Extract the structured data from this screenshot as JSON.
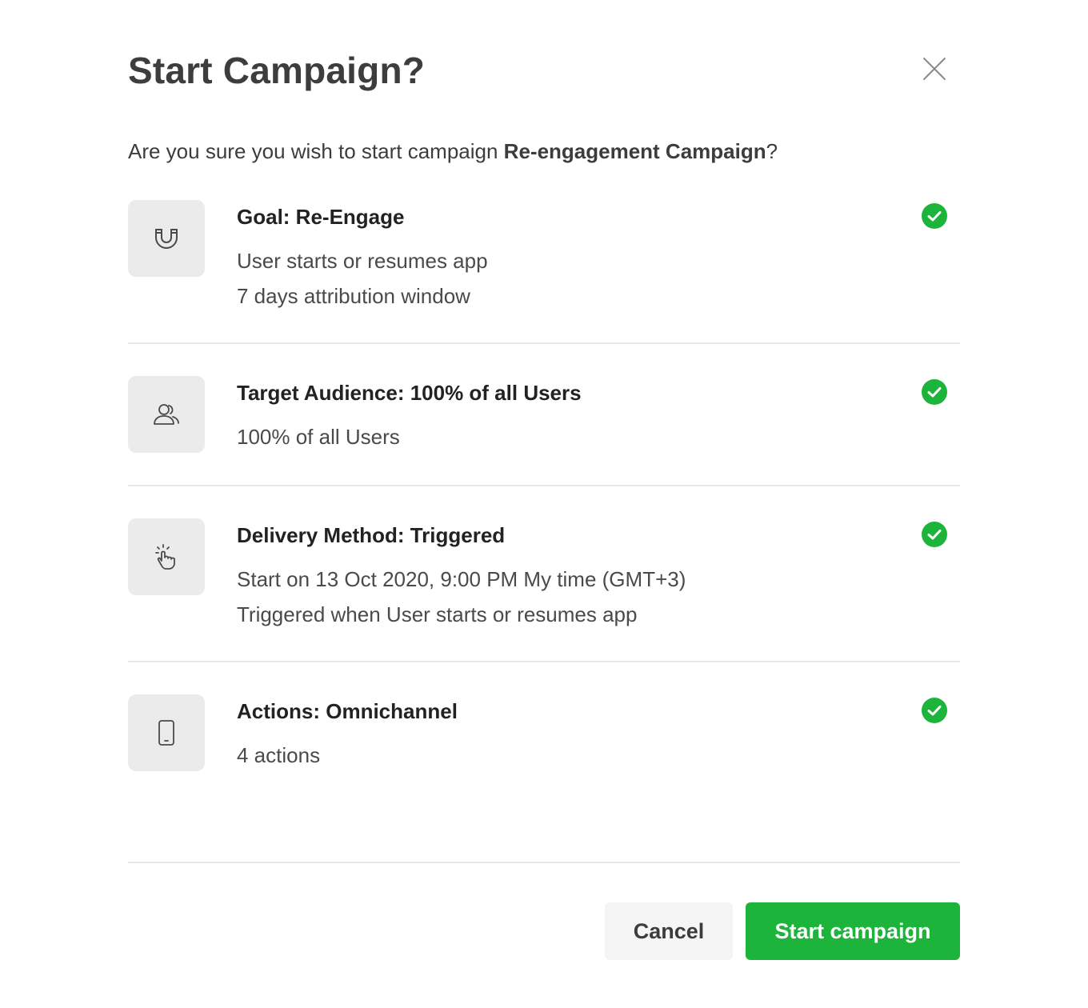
{
  "dialog": {
    "title": "Start Campaign?",
    "close_icon": "close-icon",
    "prompt_prefix": "Are you sure you wish to start campaign ",
    "campaign_name": "Re-engagement Campaign",
    "prompt_suffix": "?"
  },
  "steps": [
    {
      "icon": "magnet-icon",
      "title": "Goal: Re-Engage",
      "lines": [
        "User starts or resumes app",
        "7 days attribution window"
      ],
      "status_icon": "check-circle-icon"
    },
    {
      "icon": "users-icon",
      "title": "Target Audience: 100% of all Users",
      "lines": [
        "100% of all Users"
      ],
      "status_icon": "check-circle-icon"
    },
    {
      "icon": "tap-icon",
      "title": "Delivery Method: Triggered",
      "lines": [
        "Start on 13 Oct 2020, 9:00 PM My time (GMT+3)",
        "Triggered when User starts or resumes app"
      ],
      "status_icon": "check-circle-icon"
    },
    {
      "icon": "phone-icon",
      "title": "Actions: Omnichannel",
      "lines": [
        "4 actions"
      ],
      "status_icon": "check-circle-icon"
    }
  ],
  "footer": {
    "cancel_label": "Cancel",
    "start_label": "Start campaign"
  },
  "colors": {
    "accent": "#1db43c",
    "icon_box": "#ebebeb",
    "divider": "#e7e7e7"
  }
}
